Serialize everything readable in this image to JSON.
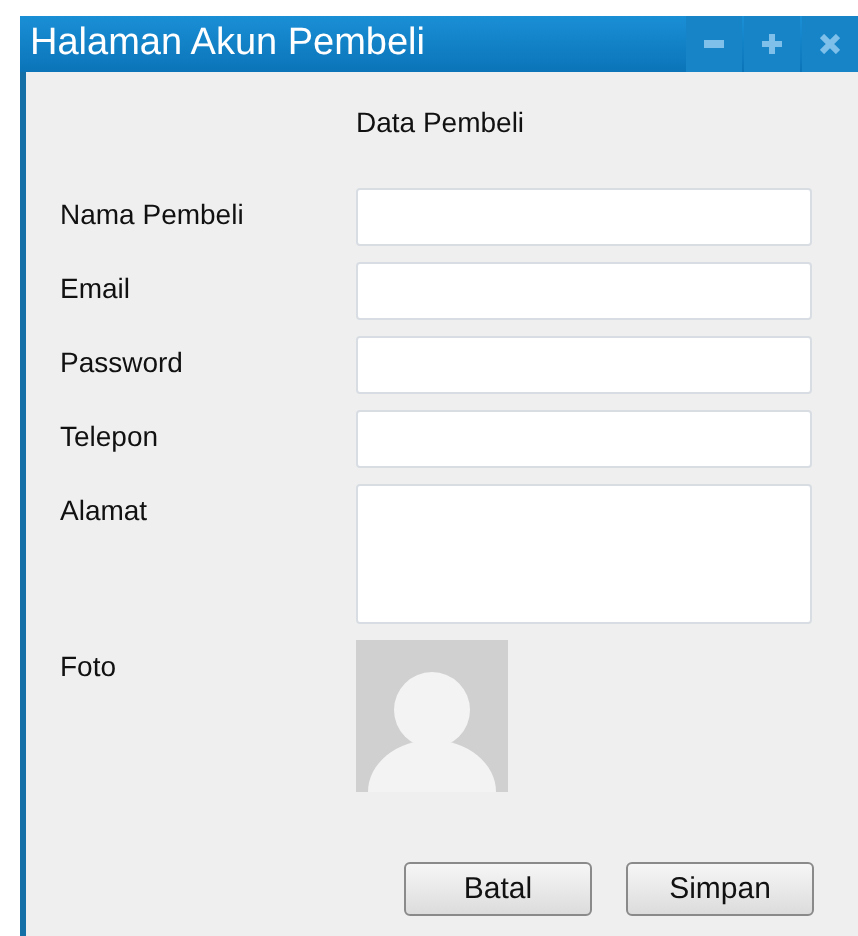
{
  "window": {
    "title": "Halaman Akun Pembeli"
  },
  "heading": "Data Pembeli",
  "fields": [
    {
      "label": "Nama Pembeli",
      "kind": "text"
    },
    {
      "label": "Email",
      "kind": "text"
    },
    {
      "label": "Password",
      "kind": "text"
    },
    {
      "label": "Telepon",
      "kind": "text"
    },
    {
      "label": "Alamat",
      "kind": "textarea"
    }
  ],
  "photo": {
    "label": "Foto",
    "kind": "picture"
  },
  "buttons": [
    "Batal",
    "Simpan"
  ]
}
